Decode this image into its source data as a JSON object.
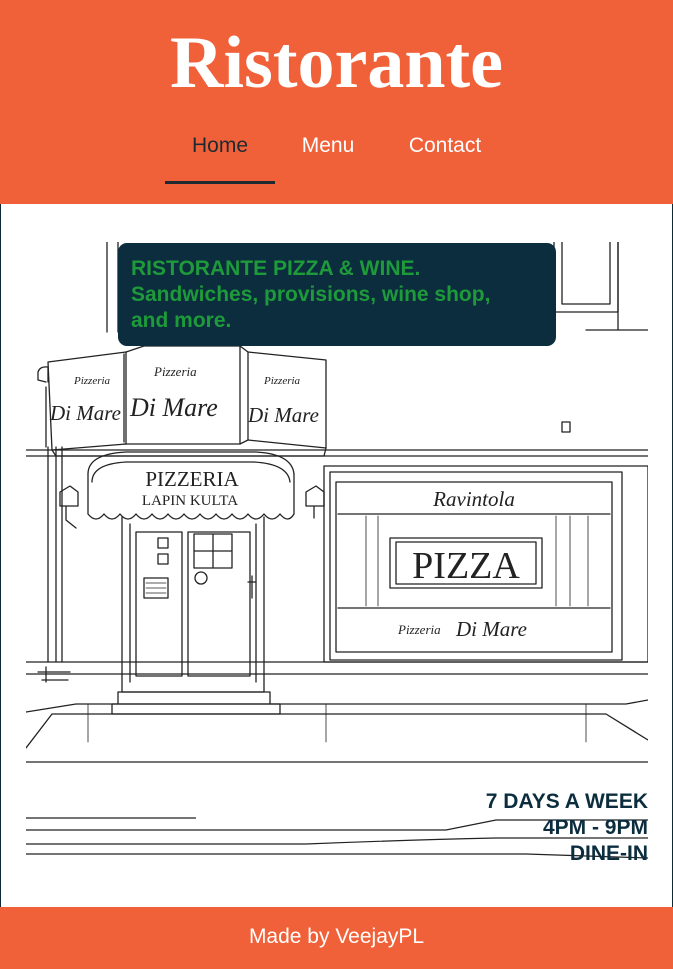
{
  "colors": {
    "brand": "#f16139",
    "dark_teal": "#0b2d3d",
    "promo_green": "#1e9a3b",
    "nav_active": "#1f2a30"
  },
  "header": {
    "title": "Ristorante"
  },
  "nav": {
    "items": [
      {
        "label": "Home",
        "active": true
      },
      {
        "label": "Menu",
        "active": false
      },
      {
        "label": "Contact",
        "active": false
      }
    ]
  },
  "promo": {
    "lines": [
      "RISTORANTE PIZZA & WINE.",
      "Sandwiches, provisions, wine shop,",
      "and more."
    ]
  },
  "storefront": {
    "sign_small": "Pizzeria",
    "sign_script": "Di Mare",
    "awning_line1": "PIZZERIA",
    "awning_line2": "LAPIN KULTA",
    "window_top": "Ravintola",
    "window_main": "PIZZA"
  },
  "hours": {
    "lines": [
      "7 DAYS A WEEK",
      "4PM - 9PM",
      "DINE-IN"
    ]
  },
  "footer": {
    "credit": "Made by VeejayPL"
  }
}
